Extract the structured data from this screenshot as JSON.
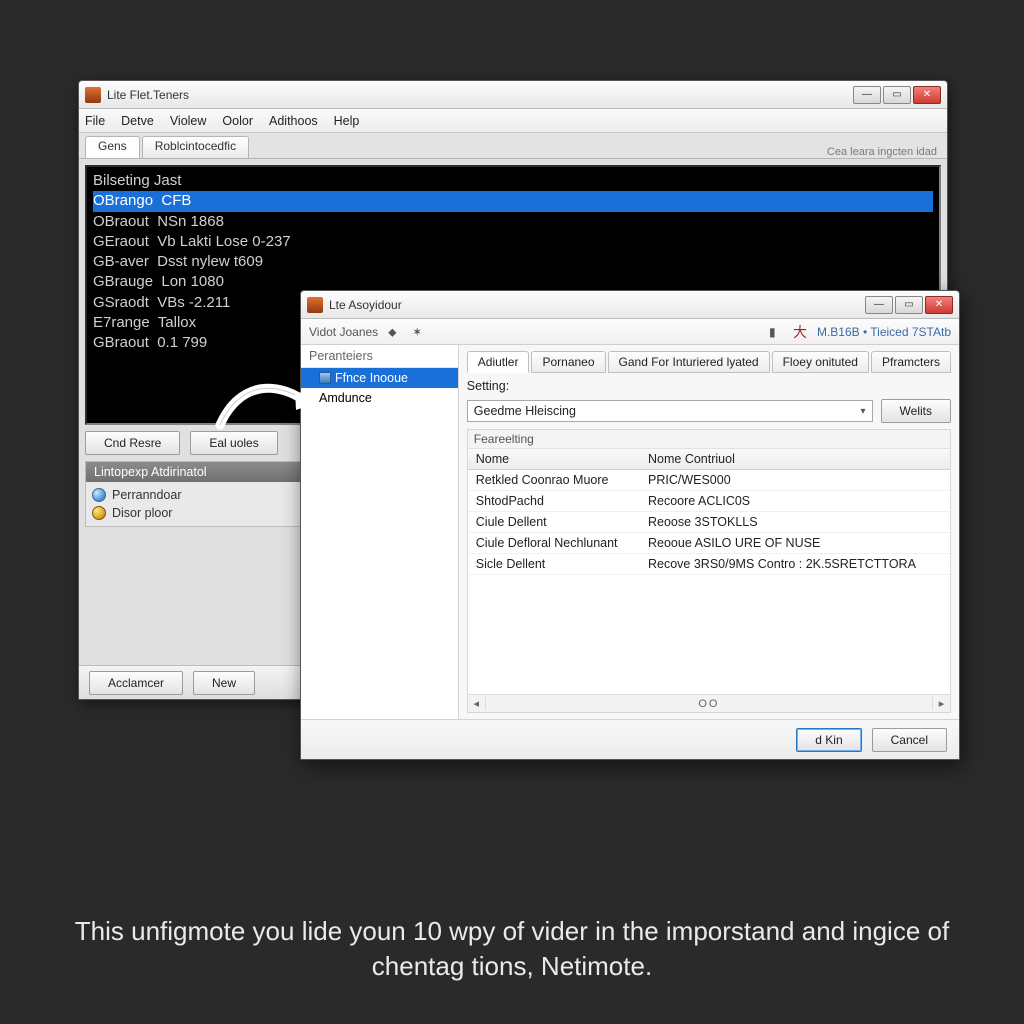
{
  "caption": "This unfigmote you lide youn 10 wpy of vider in the imporstand and ingice of chentag tions, Netimote.",
  "main_window": {
    "title": "Lite Flet.Teners",
    "menus": [
      "File",
      "Detve",
      "Violew",
      "Oolor",
      "Adithoos",
      "Help"
    ],
    "tabs": [
      "Gens",
      "Roblcintocedfic"
    ],
    "right_hint": "Cea leara ingcten idad",
    "console_lines": [
      "Bilseting Jast",
      "OBrango  CFB",
      "OBraout  NSn 1868",
      "GEraout  Vb Lakti Lose 0-237",
      "GB-aver  Dsst nylew t609",
      "GBrauge  Lon 1080",
      "GSraodt  VBs -2.211",
      "E7range  Tallox",
      "GBraout  0.1 799"
    ],
    "console_selected_index": 1,
    "buttons": {
      "left": "Cnd Resre",
      "right": "Eal uoles"
    },
    "panel_title": "Lintopexp Atdirinatol",
    "panel_items": [
      "Perranndoar",
      "Disor ploor"
    ],
    "footer_buttons": [
      "Acclamcer",
      "New"
    ]
  },
  "dialog": {
    "title": "Lte Asoyidour",
    "toolbar_left": "Vidot Joanes",
    "toolbar_crumb": "M.B16B • Tieiced 7STAtb",
    "tree_header": "Peranteiers",
    "tree_nodes": [
      "Ffnce Inooue",
      "Amdunce"
    ],
    "tree_selected_index": 0,
    "right_tabs": [
      "Adiutler",
      "Pornaneo",
      "Gand For Inturiered lyated",
      "Floey onituted",
      "Pframcters"
    ],
    "right_tab_active_index": 0,
    "setting_label": "Setting:",
    "setting_value": "Geedme Hleiscing",
    "setting_button": "Welits",
    "group_label": "Feareelting",
    "grid_headers": [
      "Nome",
      "Nome Contriuol"
    ],
    "grid_rows": [
      [
        "Retkled Coonrao Muore",
        "PRIC/WES000"
      ],
      [
        "ShtodPachd",
        "Recoore ACLIC0S"
      ],
      [
        "Ciule Dellent",
        "Reoose 3STOKLLS"
      ],
      [
        "Ciule Defloral Nechlunant",
        "Reooue ASILO URE OF NUSE"
      ],
      [
        "Sicle Dellent",
        "Recove 3RS0/9MS Contro : 2K.5SRETCTTORA"
      ]
    ],
    "scroll_track": "OO",
    "ok_button": "d Kin",
    "cancel_button": "Cancel"
  }
}
